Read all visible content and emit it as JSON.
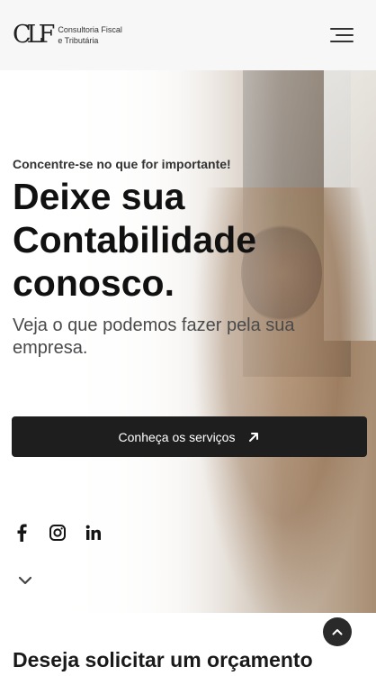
{
  "header": {
    "logo_mark": "CLF",
    "logo_line1": "Consultoria Fiscal",
    "logo_line2": "e Tributária"
  },
  "hero": {
    "eyebrow": "Concentre-se no que for importante!",
    "headline": "Deixe sua Contabilidade conosco.",
    "subtitle": "Veja o que podemos fazer pela sua empresa.",
    "cta_label": "Conheça os serviços"
  },
  "social": [
    "facebook-icon",
    "instagram-icon",
    "linkedin-icon"
  ],
  "next_section": {
    "title": "Deseja solicitar um orçamento"
  },
  "colors": {
    "button_bg": "#1e1e1e",
    "text_primary": "#111111",
    "header_bg": "#f7f7f7"
  }
}
